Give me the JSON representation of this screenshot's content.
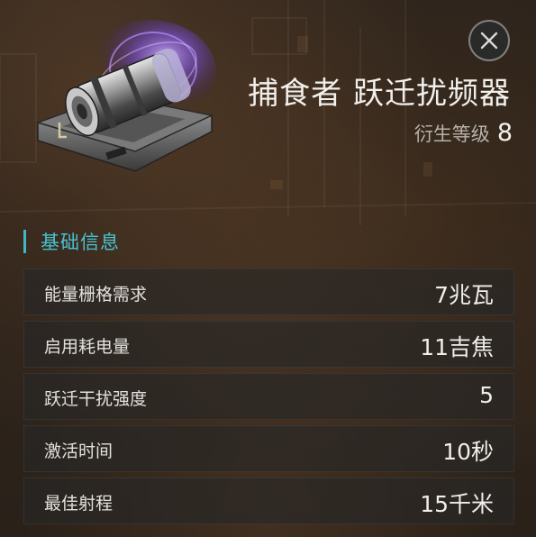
{
  "window": {
    "close_icon": "close-x-icon",
    "accent_color": "#46c2d1"
  },
  "item": {
    "name": "捕食者 跃迁扰频器",
    "image_icon": "warp-scrambler-module-icon",
    "level_label": "衍生等级",
    "level_value": "8"
  },
  "section": {
    "title": "基础信息"
  },
  "stats": [
    {
      "label": "能量栅格需求",
      "value": "7兆瓦"
    },
    {
      "label": "启用耗电量",
      "value": "11吉焦"
    },
    {
      "label": "跃迁干扰强度",
      "value": "5"
    },
    {
      "label": "激活时间",
      "value": "10秒"
    },
    {
      "label": "最佳射程",
      "value": "15千米"
    }
  ]
}
